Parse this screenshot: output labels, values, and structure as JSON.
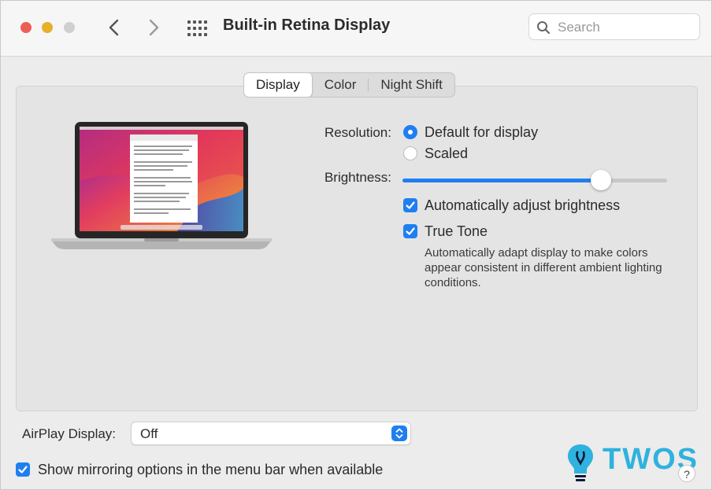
{
  "window": {
    "title": "Built-in Retina Display"
  },
  "search": {
    "placeholder": "Search"
  },
  "tabs": [
    {
      "label": "Display",
      "active": true
    },
    {
      "label": "Color",
      "active": false
    },
    {
      "label": "Night Shift",
      "active": false
    }
  ],
  "resolution": {
    "label": "Resolution:",
    "options": [
      {
        "label": "Default for display",
        "selected": true
      },
      {
        "label": "Scaled",
        "selected": false
      }
    ]
  },
  "brightness": {
    "label": "Brightness:",
    "value": 0.75
  },
  "auto_brightness": {
    "label": "Automatically adjust brightness",
    "checked": true
  },
  "true_tone": {
    "label": "True Tone",
    "checked": true,
    "description": "Automatically adapt display to make colors appear consistent in different ambient lighting conditions."
  },
  "airplay": {
    "label": "AirPlay Display:",
    "value": "Off"
  },
  "mirroring": {
    "label": "Show mirroring options in the menu bar when available",
    "checked": true
  },
  "help": {
    "label": "?"
  },
  "watermark": {
    "text": "TWOS"
  },
  "colors": {
    "accent": "#1f7ff0",
    "close": "#ec5f56",
    "minimize": "#e7b02a",
    "watermark": "#2fb2dd"
  }
}
